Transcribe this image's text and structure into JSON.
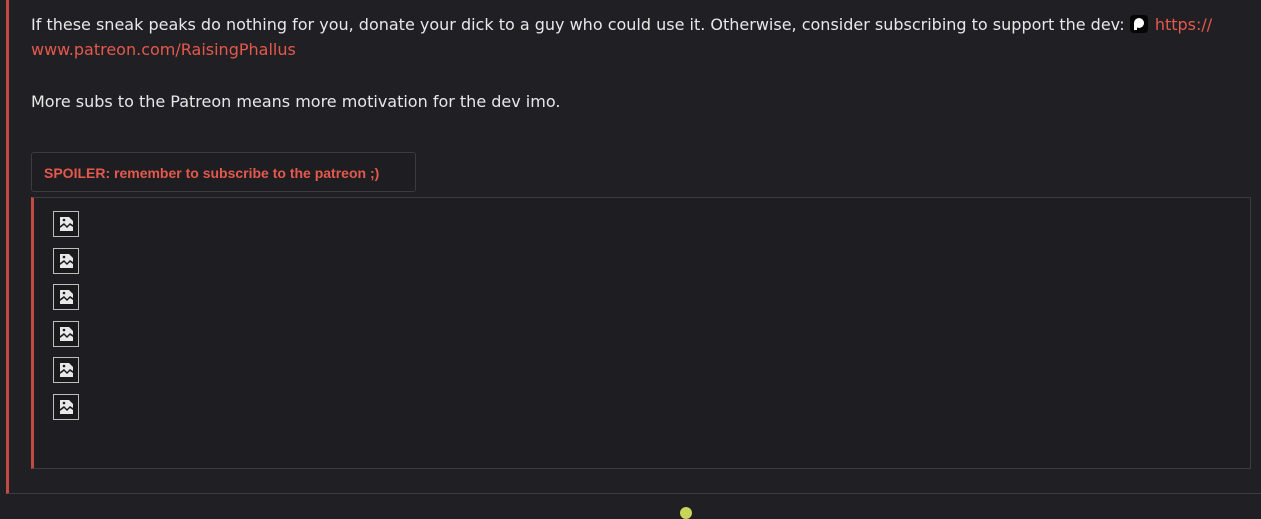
{
  "post": {
    "paragraph1_text": "If these sneak peaks do nothing for you, donate your dick to a guy who could use it. Otherwise, consider subscribing to support the dev: ",
    "patreon_link_text": "https:// www.patreon.com/RaisingPhallus",
    "paragraph2_text": "More subs to the Patreon means more motivation for the dev imo."
  },
  "spoiler": {
    "button_label": "SPOILER: remember to subscribe to the patreon ;)",
    "image_count": 6,
    "image_icon": "broken-image-icon"
  },
  "colors": {
    "background": "#202024",
    "accent": "#e5584c",
    "quote_border": "#c14b43",
    "text": "#e8e8e8"
  }
}
